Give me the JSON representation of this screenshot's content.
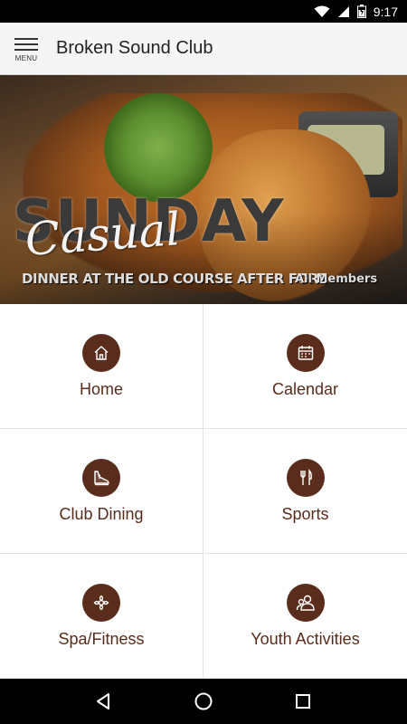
{
  "status_bar": {
    "time": "9:17",
    "icons": [
      "wifi-icon",
      "signal-icon",
      "battery-icon"
    ]
  },
  "app_bar": {
    "menu_label": "MENU",
    "title": "Broken Sound Club"
  },
  "banner": {
    "script_text": "Casual",
    "headline": "SUNDAY",
    "tagline": "DINNER AT THE OLD COURSE AFTER FORE",
    "audience": "All Members"
  },
  "tiles": [
    {
      "label": "Home",
      "icon": "home-icon"
    },
    {
      "label": "Calendar",
      "icon": "calendar-icon"
    },
    {
      "label": "Club Dining",
      "icon": "running-shoe-icon"
    },
    {
      "label": "Sports",
      "icon": "fork-knife-icon"
    },
    {
      "label": "Spa/Fitness",
      "icon": "spa-flower-icon"
    },
    {
      "label": "Youth Activities",
      "icon": "people-icon"
    }
  ],
  "colors": {
    "accent": "#5a2c1c",
    "app_bar_bg": "#f5f5f5",
    "status_bar_bg": "#000000"
  },
  "nav_bar": {
    "icons": [
      "back-icon",
      "home-circle-icon",
      "recents-icon"
    ]
  }
}
